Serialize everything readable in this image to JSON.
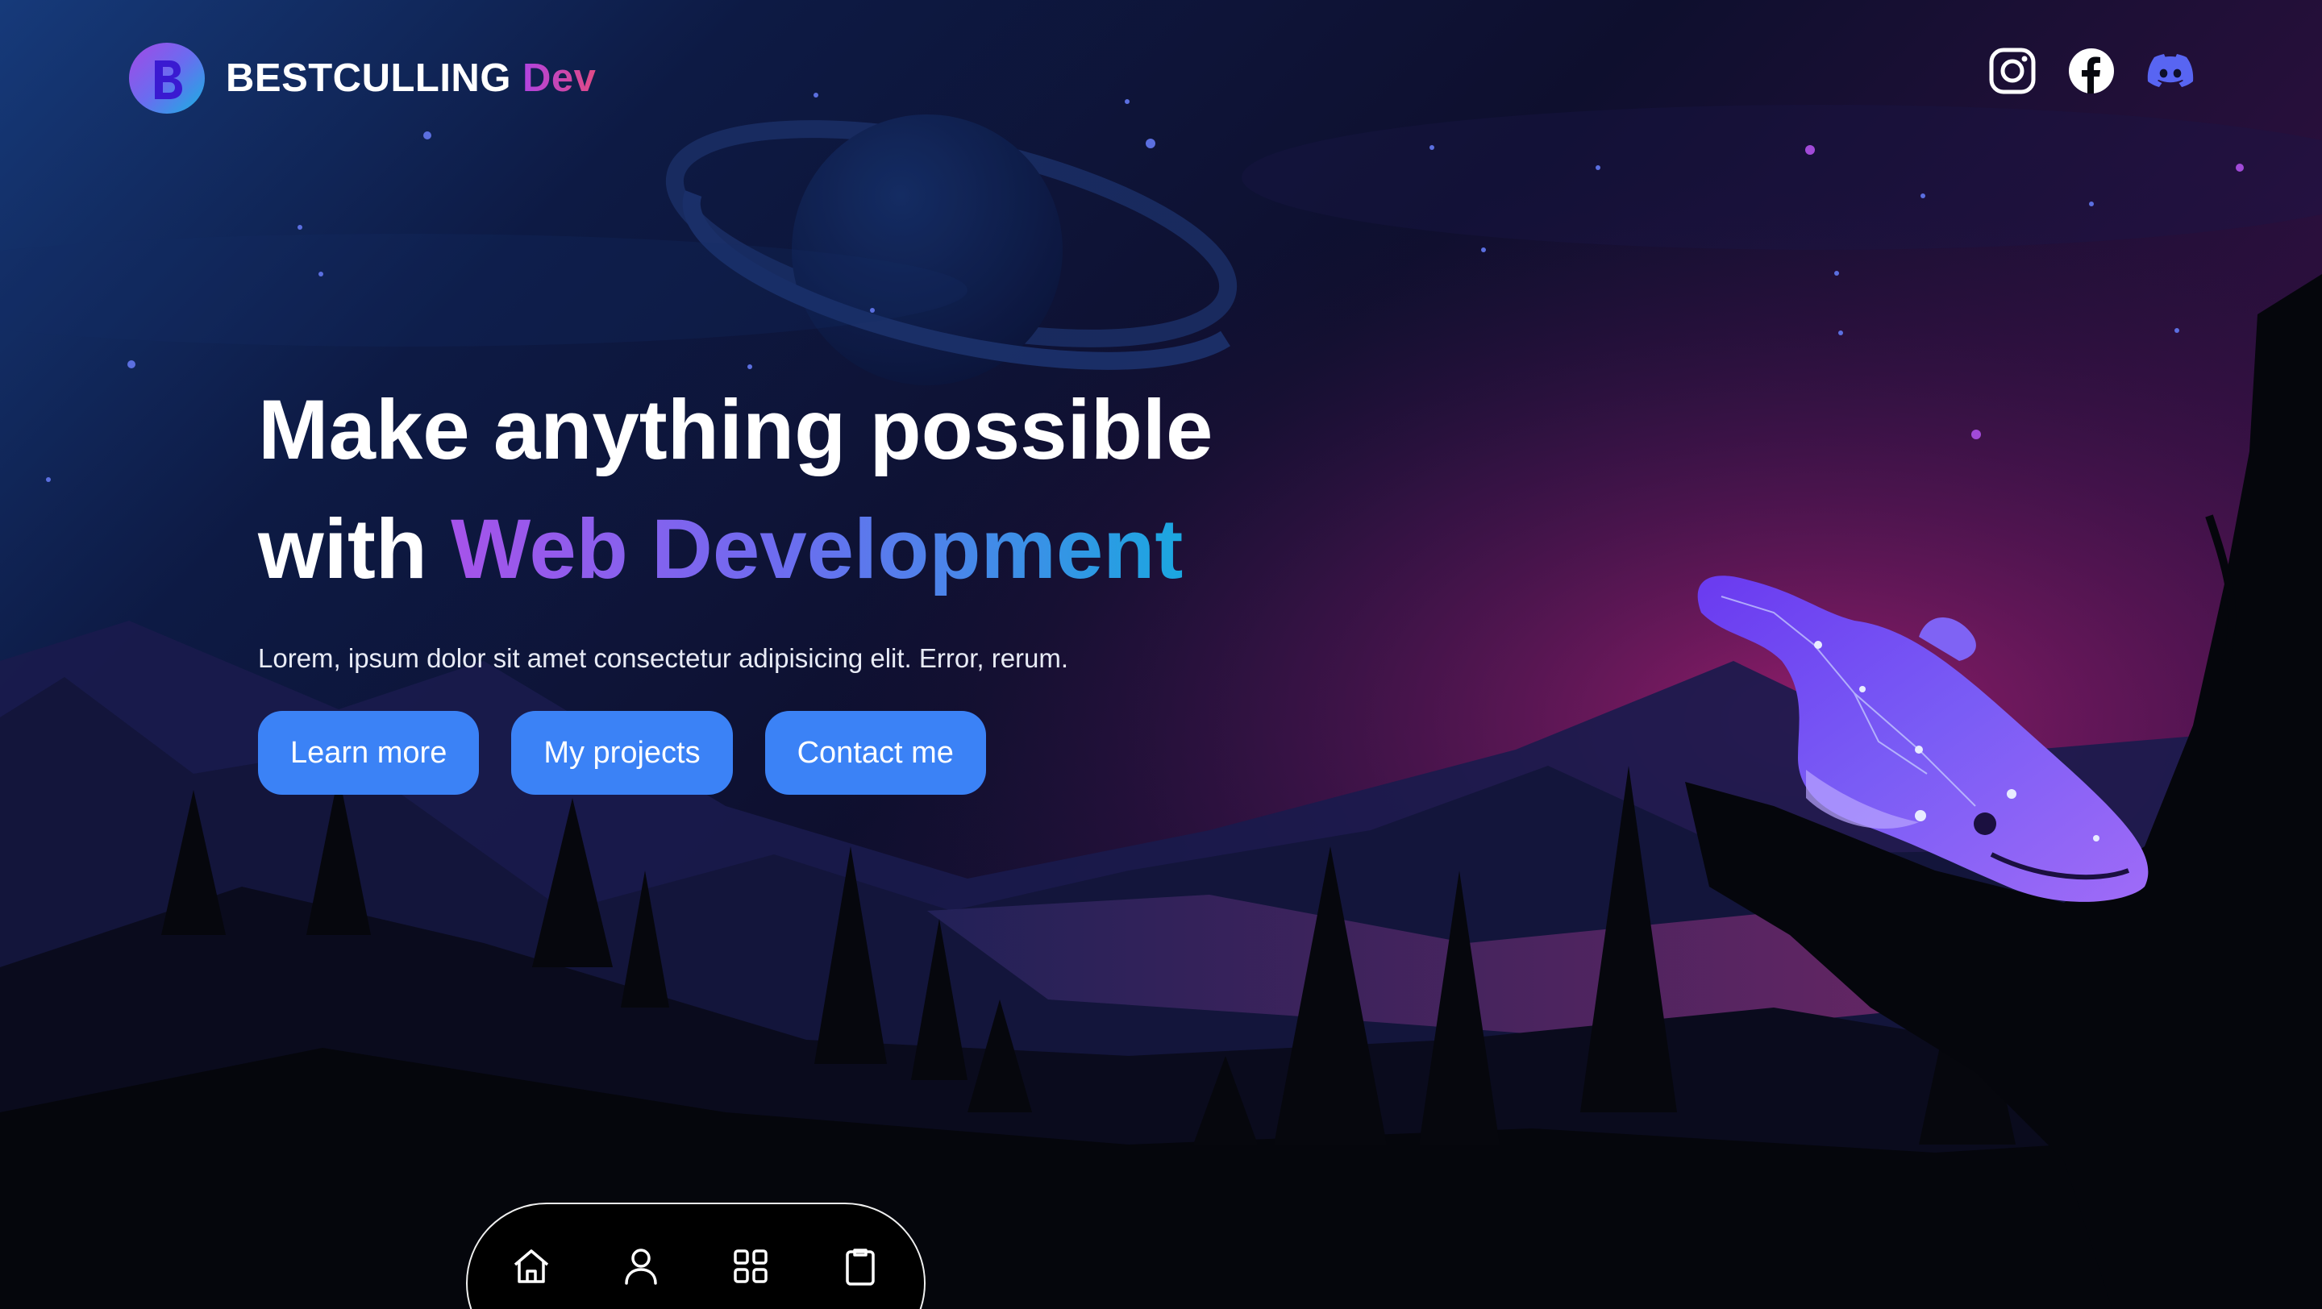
{
  "header": {
    "brand_name": "BESTCULLING",
    "brand_suffix": "Dev",
    "logo_letter": "B",
    "socials": [
      {
        "name": "instagram",
        "icon": "instagram-icon",
        "color": "#ffffff"
      },
      {
        "name": "facebook",
        "icon": "facebook-icon",
        "color": "#ffffff"
      },
      {
        "name": "discord",
        "icon": "discord-icon",
        "color": "#5865f2"
      }
    ]
  },
  "hero": {
    "title_line1": "Make anything possible",
    "title_line2_prefix": "with ",
    "title_line2_highlight": "Web Development",
    "description": "Lorem, ipsum dolor sit amet consectetur adipisicing elit. Error, rerum.",
    "buttons": {
      "learn_more": "Learn more",
      "my_projects": "My projects",
      "contact_me": "Contact me"
    }
  },
  "bottom_nav": {
    "items": [
      {
        "icon": "home-icon"
      },
      {
        "icon": "user-icon"
      },
      {
        "icon": "grid-icon"
      },
      {
        "icon": "clipboard-icon"
      }
    ]
  },
  "colors": {
    "accent_button": "#3b82f6",
    "gradient_start": "#a653ea",
    "gradient_end": "#1ba7e0",
    "background": "#07080f"
  }
}
